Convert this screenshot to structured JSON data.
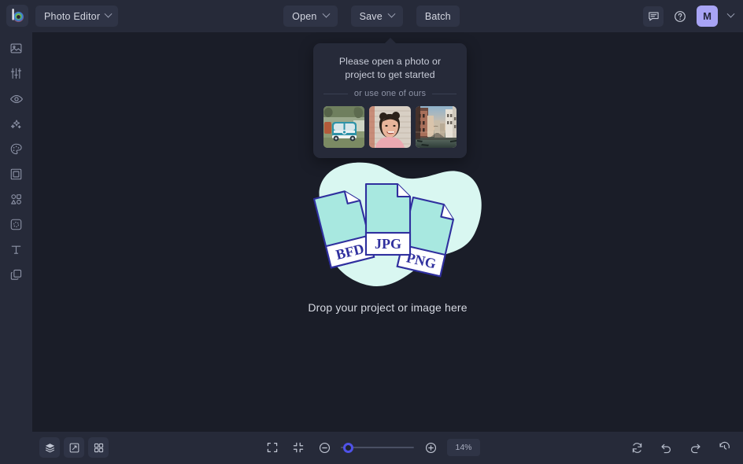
{
  "app": {
    "logo_icon": "befunky-logo-icon",
    "menu_label": "Photo Editor",
    "menu_chevron_icon": "chevron-down-icon"
  },
  "toolbar": {
    "open_label": "Open",
    "open_chevron_icon": "chevron-down-icon",
    "save_label": "Save",
    "save_chevron_icon": "chevron-down-icon",
    "batch_label": "Batch",
    "feedback_icon": "chat-bubble-icon",
    "help_icon": "question-circle-icon",
    "avatar_initial": "M",
    "avatar_chevron_icon": "chevron-down-icon",
    "avatar_color": "#a8a4f5"
  },
  "sidebar": {
    "items": [
      {
        "name": "sidebar-item-image",
        "icon": "image-icon"
      },
      {
        "name": "sidebar-item-edit",
        "icon": "sliders-icon"
      },
      {
        "name": "sidebar-item-touchup",
        "icon": "eye-icon"
      },
      {
        "name": "sidebar-item-ai",
        "icon": "sparkles-icon"
      },
      {
        "name": "sidebar-item-artsy",
        "icon": "palette-icon"
      },
      {
        "name": "sidebar-item-frames",
        "icon": "frame-icon"
      },
      {
        "name": "sidebar-item-graphics",
        "icon": "shapes-icon"
      },
      {
        "name": "sidebar-item-overlays",
        "icon": "overlay-icon"
      },
      {
        "name": "sidebar-item-text",
        "icon": "text-icon"
      },
      {
        "name": "sidebar-item-layers",
        "icon": "layers-icon"
      }
    ]
  },
  "popover": {
    "title": "Please open a photo or project to get started",
    "divider_label": "or use one of ours",
    "samples": [
      {
        "name": "sample-thumbnail-van",
        "alt": "teal vintage van on grass"
      },
      {
        "name": "sample-thumbnail-portrait",
        "alt": "smiling woman with hair buns"
      },
      {
        "name": "sample-thumbnail-canal",
        "alt": "venice canal at sunset"
      }
    ]
  },
  "drop_zone": {
    "label": "Drop your project or image here",
    "blob_color": "#d9f7f1",
    "card_fill": "#a8e8e0",
    "card_stroke": "#2f2f9e",
    "cards": [
      {
        "label": "BFD",
        "rotation": -14
      },
      {
        "label": "JPG",
        "rotation": 0
      },
      {
        "label": "PNG",
        "rotation": 13
      }
    ]
  },
  "statusbar": {
    "left_tools": [
      {
        "name": "layers-panel-button",
        "icon": "layers-stack-icon"
      },
      {
        "name": "resize-button",
        "icon": "resize-icon"
      },
      {
        "name": "grid-button",
        "icon": "grid-icon"
      }
    ],
    "fit_screen_icon": "fit-to-screen-icon",
    "fit_content_icon": "fit-content-icon",
    "zoom_out_icon": "minus-circle-icon",
    "zoom_in_icon": "plus-circle-icon",
    "zoom_value": "14%",
    "zoom_percent": 14,
    "slider_position_percent": 4,
    "accent_color": "#4f52e8",
    "right_tools": [
      {
        "name": "reset-button",
        "icon": "reset-icon"
      },
      {
        "name": "undo-button",
        "icon": "undo-icon"
      },
      {
        "name": "redo-button",
        "icon": "redo-icon"
      },
      {
        "name": "history-button",
        "icon": "history-icon"
      }
    ]
  }
}
